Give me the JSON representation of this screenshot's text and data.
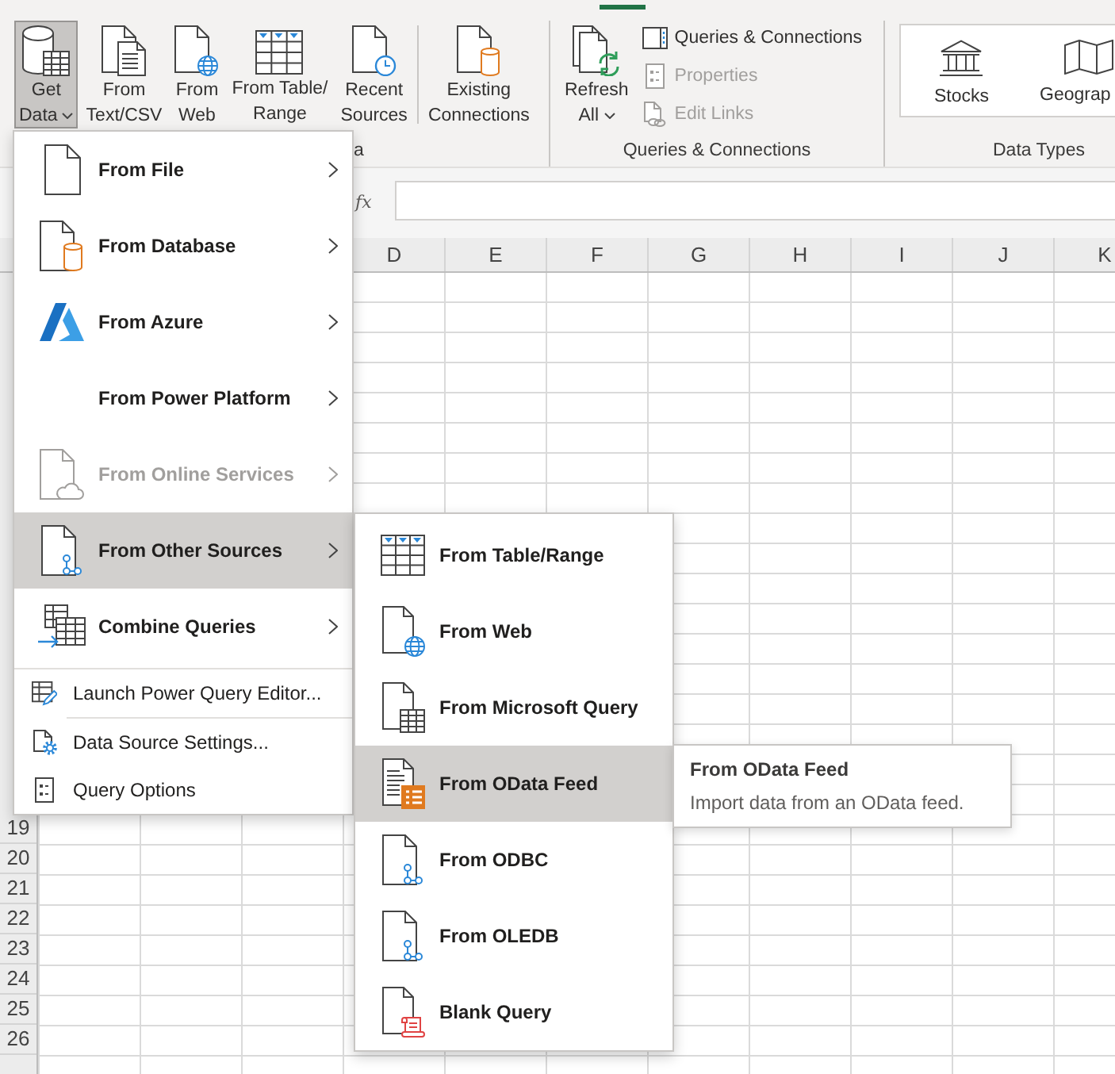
{
  "ribbon": {
    "groups": [
      {
        "label": "a",
        "buttons": [
          {
            "lines": [
              "Get",
              "Data"
            ],
            "dropdown": true,
            "pressed": true
          },
          {
            "lines": [
              "From",
              "Text/CSV"
            ],
            "dropdown": false,
            "pressed": false
          },
          {
            "lines": [
              "From",
              "Web"
            ],
            "dropdown": false,
            "pressed": false
          },
          {
            "lines": [
              "From Table/",
              "Range"
            ],
            "dropdown": false,
            "pressed": false
          },
          {
            "lines": [
              "Recent",
              "Sources"
            ],
            "dropdown": false,
            "pressed": false
          },
          {
            "lines": [
              "Existing",
              "Connections"
            ],
            "dropdown": false,
            "pressed": false,
            "separator_before": true
          }
        ]
      },
      {
        "label": "Queries & Connections",
        "buttons": [
          {
            "lines": [
              "Refresh",
              "All"
            ],
            "dropdown": true,
            "pressed": false
          }
        ],
        "small_buttons": [
          {
            "label": "Queries & Connections",
            "disabled": false
          },
          {
            "label": "Properties",
            "disabled": true
          },
          {
            "label": "Edit Links",
            "disabled": true
          }
        ]
      },
      {
        "label": "Data Types",
        "gallery": [
          {
            "label": "Stocks"
          },
          {
            "label": "Geograp"
          }
        ]
      }
    ]
  },
  "formula_bar": {
    "function_label": "fx"
  },
  "sheet": {
    "columns": [
      "D",
      "E",
      "F",
      "G",
      "H",
      "I",
      "J",
      "K"
    ],
    "rows": [
      "19",
      "20",
      "21",
      "22",
      "23",
      "24",
      "25",
      "26"
    ]
  },
  "menu": {
    "items": [
      {
        "kind": "large",
        "label": "From File",
        "submenu": true,
        "disabled": false,
        "selected": false
      },
      {
        "kind": "large",
        "label": "From Database",
        "submenu": true,
        "disabled": false,
        "selected": false
      },
      {
        "kind": "large",
        "label": "From Azure",
        "submenu": true,
        "disabled": false,
        "selected": false
      },
      {
        "kind": "large",
        "label": "From Power Platform",
        "submenu": true,
        "disabled": false,
        "selected": false
      },
      {
        "kind": "large",
        "label": "From Online Services",
        "submenu": true,
        "disabled": true,
        "selected": false
      },
      {
        "kind": "large",
        "label": "From Other Sources",
        "submenu": true,
        "disabled": false,
        "selected": true
      },
      {
        "kind": "large",
        "label": "Combine Queries",
        "submenu": true,
        "disabled": false,
        "selected": false
      },
      {
        "kind": "separator"
      },
      {
        "kind": "small",
        "label": "Launch Power Query Editor...",
        "submenu": false,
        "disabled": false,
        "selected": false
      },
      {
        "kind": "separator"
      },
      {
        "kind": "small",
        "label": "Data Source Settings...",
        "submenu": false,
        "disabled": false,
        "selected": false
      },
      {
        "kind": "small",
        "label": "Query Options",
        "submenu": false,
        "disabled": false,
        "selected": false
      }
    ]
  },
  "submenu": {
    "items": [
      {
        "label": "From Table/Range",
        "selected": false
      },
      {
        "label": "From Web",
        "selected": false
      },
      {
        "label": "From Microsoft Query",
        "selected": false
      },
      {
        "label": "From OData Feed",
        "selected": true
      },
      {
        "label": "From ODBC",
        "selected": false
      },
      {
        "label": "From OLEDB",
        "selected": false
      },
      {
        "label": "Blank Query",
        "selected": false
      }
    ]
  },
  "tooltip": {
    "title": "From OData Feed",
    "description": "Import data from an OData feed."
  }
}
